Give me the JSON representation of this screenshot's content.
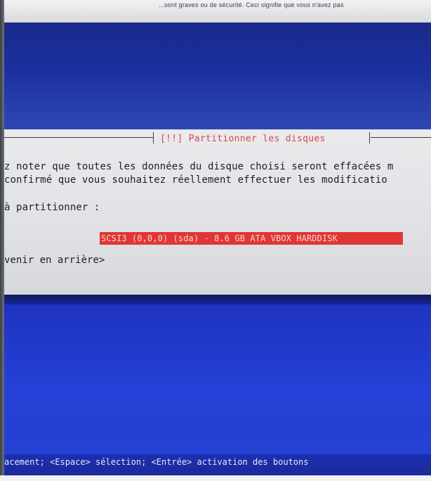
{
  "top_strip": {
    "text": "...sont graves ou de sécurité. Ceci signifie que vous n'avez pas"
  },
  "dialog": {
    "title": "[!!] Partitionner les disques",
    "message_line1": "z noter que toutes les données du disque choisi seront effacées m",
    "message_line2": " confirmé que vous souhaitez réellement effectuer les modificatio",
    "prompt_label": "à partitionner :",
    "disk_option": "SCSI3 (0,0,0) (sda) - 8.6 GB ATA VBOX HARDDISK",
    "back_button": "venir en arrière>"
  },
  "status_bar": {
    "text": "acement; <Espace> sélection; <Entrée> activation des boutons"
  },
  "colors": {
    "background_blue": "#2440d6",
    "dialog_bg": "#e3e5e8",
    "title_red": "#d94a4a",
    "selection_red": "#e03636"
  }
}
